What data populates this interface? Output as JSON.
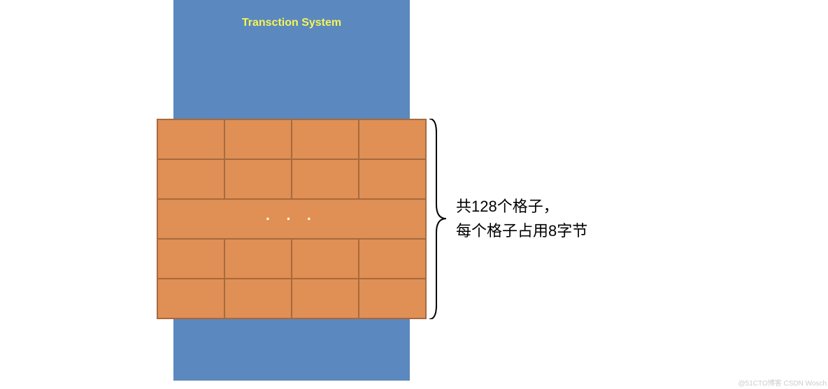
{
  "title": "Transction System",
  "ellipsis": "· · ·",
  "annotation_line1": "共128个格子，",
  "annotation_line2": "每个格子占用8字节",
  "watermark": "@51CTO博客 CSDN Wosch",
  "colors": {
    "container": "#5b88bf",
    "grid": "#e08f55",
    "gridBorder": "#a66a3f",
    "titleColor": "#f5f555"
  },
  "grid": {
    "rows": 5,
    "cols": 4,
    "ellipsisRow": 2,
    "totalSlots": 128,
    "bytesPerSlot": 8
  }
}
